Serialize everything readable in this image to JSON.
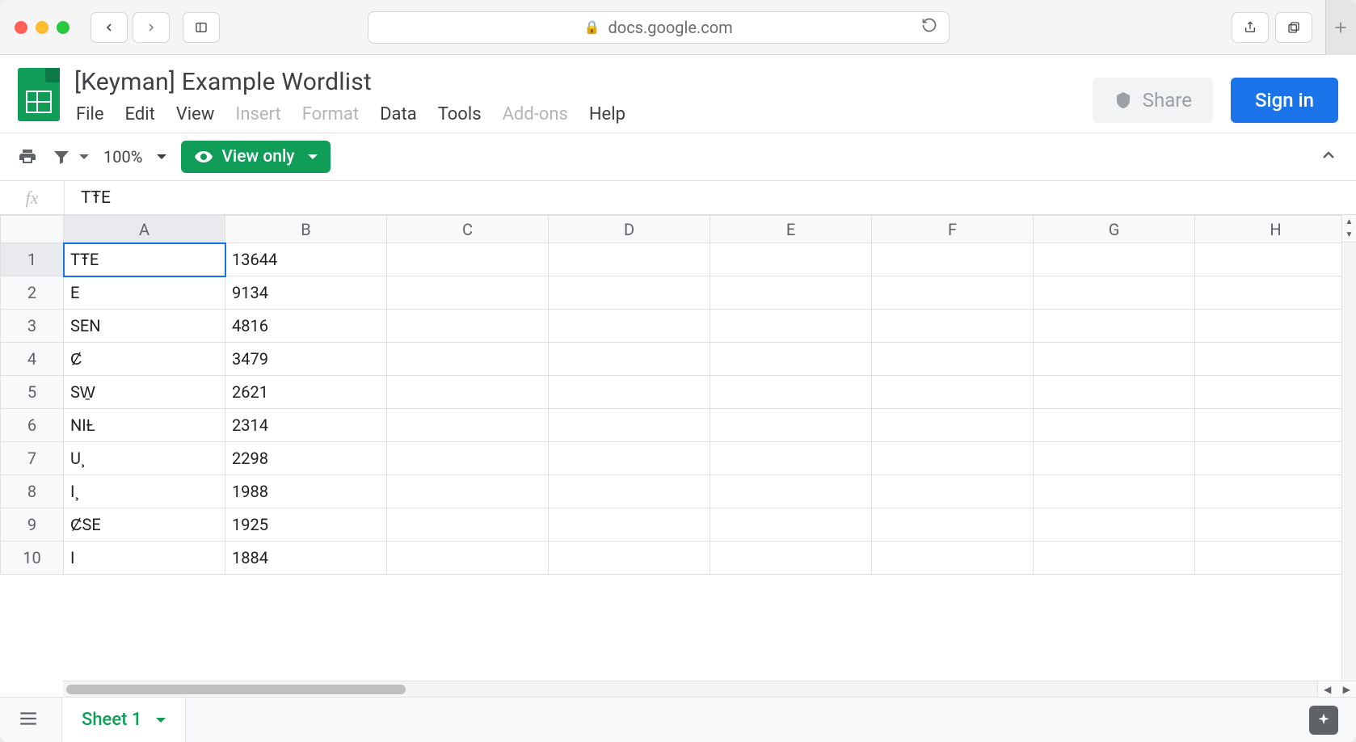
{
  "browser": {
    "url": "docs.google.com"
  },
  "doc": {
    "title": "[Keyman] Example Wordlist",
    "menus": {
      "file": "File",
      "edit": "Edit",
      "view": "View",
      "insert": "Insert",
      "format": "Format",
      "data": "Data",
      "tools": "Tools",
      "addons": "Add-ons",
      "help": "Help"
    },
    "share": "Share",
    "signin": "Sign in"
  },
  "toolbar": {
    "zoom": "100%",
    "viewonly": "View only"
  },
  "formula": {
    "fx": "fx",
    "value": "TŦE"
  },
  "columns": [
    "A",
    "B",
    "C",
    "D",
    "E",
    "F",
    "G",
    "H"
  ],
  "rows": [
    {
      "n": "1",
      "a": "TŦE",
      "b": "13644"
    },
    {
      "n": "2",
      "a": "E",
      "b": "9134"
    },
    {
      "n": "3",
      "a": "SEN",
      "b": "4816"
    },
    {
      "n": "4",
      "a": "Ȼ",
      "b": "3479"
    },
    {
      "n": "5",
      "a": "SW̱",
      "b": "2621"
    },
    {
      "n": "6",
      "a": "NIȽ",
      "b": "2314"
    },
    {
      "n": "7",
      "a": "U¸",
      "b": "2298"
    },
    {
      "n": "8",
      "a": "I¸",
      "b": "1988"
    },
    {
      "n": "9",
      "a": "ȻSE",
      "b": "1925"
    },
    {
      "n": "10",
      "a": "I",
      "b": "1884"
    }
  ],
  "sheet_tab": "Sheet 1"
}
